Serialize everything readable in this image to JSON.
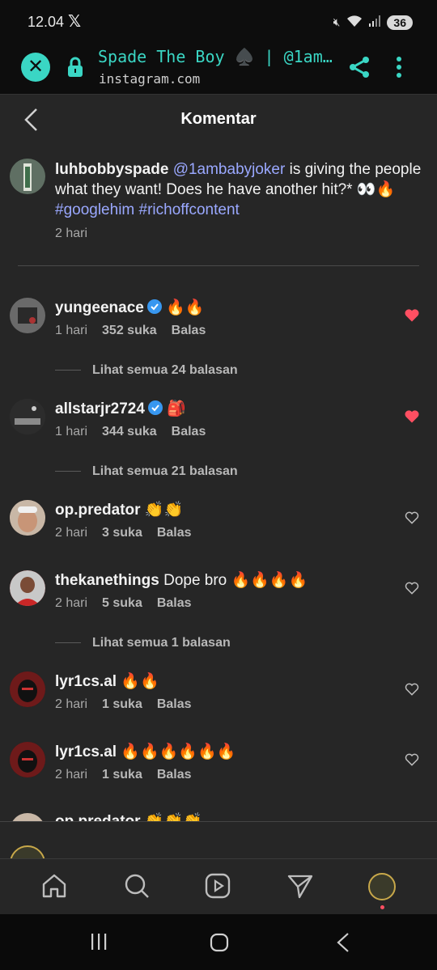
{
  "status_bar": {
    "time": "12.04",
    "battery": "36"
  },
  "browser": {
    "title": "Spade The Boy ♠️ | @1amba...",
    "url": "instagram.com",
    "accent_color": "#3ad6c4"
  },
  "header": {
    "title": "Komentar"
  },
  "caption": {
    "username": "luhbobbyspade",
    "mention": "@1ambabyjoker",
    "text": " is giving the people what they want! Does he have another hit?* 👀🔥 ",
    "hashtag1": "#googlehim",
    "hashtag2": "#richoffcontent",
    "time": "2 hari"
  },
  "comments": [
    {
      "username": "yungeenace",
      "verified": true,
      "text": " 🔥🔥",
      "time": "1 hari",
      "likes": "352 suka",
      "reply": "Balas",
      "liked": true,
      "view_replies": "Lihat semua 24 balasan"
    },
    {
      "username": "allstarjr2724",
      "verified": true,
      "text": " 🎒",
      "time": "1 hari",
      "likes": "344 suka",
      "reply": "Balas",
      "liked": true,
      "view_replies": "Lihat semua 21 balasan"
    },
    {
      "username": "op.predator",
      "verified": false,
      "text": " 👏👏",
      "time": "2 hari",
      "likes": "3 suka",
      "reply": "Balas",
      "liked": false
    },
    {
      "username": "thekanethings",
      "verified": false,
      "text": " Dope bro 🔥🔥🔥🔥",
      "time": "2 hari",
      "likes": "5 suka",
      "reply": "Balas",
      "liked": false,
      "view_replies": "Lihat semua 1 balasan"
    },
    {
      "username": "lyr1cs.al",
      "verified": false,
      "text": " 🔥🔥",
      "time": "2 hari",
      "likes": "1 suka",
      "reply": "Balas",
      "liked": false
    },
    {
      "username": "lyr1cs.al",
      "verified": false,
      "text": " 🔥🔥🔥🔥🔥🔥",
      "time": "2 hari",
      "likes": "1 suka",
      "reply": "Balas",
      "liked": false
    },
    {
      "username": "op.predator",
      "verified": false,
      "text": " 👏👏👏",
      "partially_hidden": true
    }
  ],
  "colors": {
    "background": "#262626",
    "like_red": "#ff4f62",
    "link_blue": "#9aa8ff"
  },
  "nav": [
    "home-icon",
    "search-icon",
    "reels-icon",
    "direct-icon",
    "profile-avatar"
  ]
}
